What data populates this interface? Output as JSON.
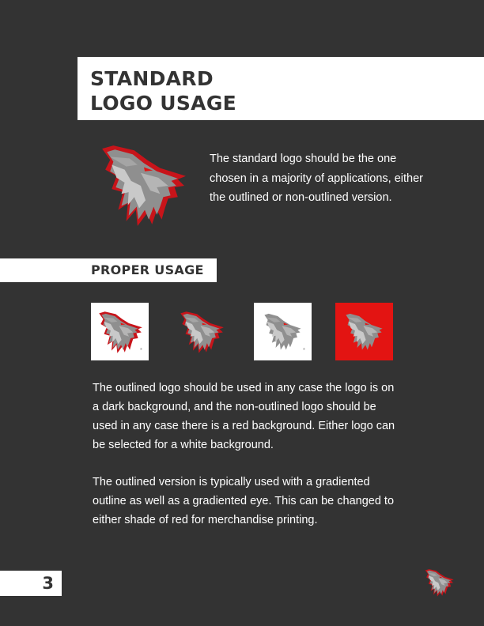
{
  "header": {
    "title_line_1": "STANDARD",
    "title_line_2": "LOGO USAGE"
  },
  "intro": {
    "text": "The standard logo should be the one chosen in a majority of applications, either the outlined or non-outlined version."
  },
  "section": {
    "label": "PROPER USAGE"
  },
  "samples": [
    {
      "background": "white",
      "outlined": true,
      "registered_mark": "®"
    },
    {
      "background": "dark",
      "outlined": true
    },
    {
      "background": "white",
      "outlined": false,
      "registered_mark": "®"
    },
    {
      "background": "red",
      "outlined": false
    }
  ],
  "body": {
    "paragraph_1": "The outlined logo should be used in any case the logo is on a dark background, and the non-outlined logo should be used in any case there is a red background. Either logo can be selected for a white background.",
    "paragraph_2": "The outlined version is typically used with a gradiented outline as well as a gradiented eye. This can be changed to either shade of red for merchandise printing."
  },
  "footer": {
    "page_number": "3"
  },
  "colors": {
    "page_bg": "#333333",
    "brand_red": "#e31412",
    "outline_red": "#c8141a",
    "wolf_gray": "#8f8f8f",
    "wolf_light": "#c9c9c9"
  }
}
